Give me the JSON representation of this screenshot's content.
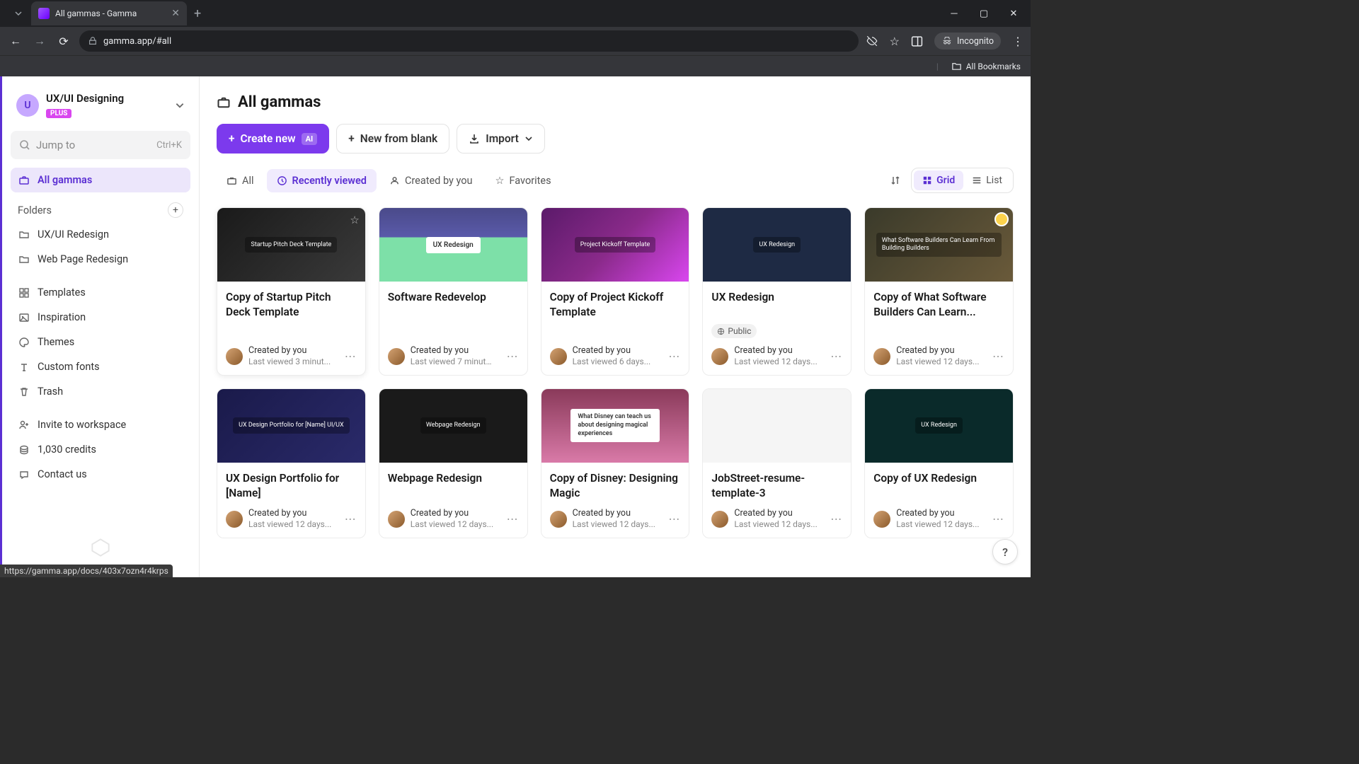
{
  "browser": {
    "tab_title": "All gammas - Gamma",
    "url": "gamma.app/#all",
    "incognito_label": "Incognito",
    "bookmarks_label": "All Bookmarks"
  },
  "workspace": {
    "avatar_letter": "U",
    "name": "UX/UI Designing",
    "badge": "PLUS"
  },
  "jump": {
    "placeholder": "Jump to",
    "shortcut": "Ctrl+K"
  },
  "sidebar": {
    "all_gammas": "All gammas",
    "folders_label": "Folders",
    "folders": [
      {
        "label": "UX/UI Redesign"
      },
      {
        "label": "Web Page Redesign"
      }
    ],
    "links": [
      {
        "label": "Templates",
        "icon": "grid"
      },
      {
        "label": "Inspiration",
        "icon": "image"
      },
      {
        "label": "Themes",
        "icon": "palette"
      },
      {
        "label": "Custom fonts",
        "icon": "type"
      },
      {
        "label": "Trash",
        "icon": "trash"
      }
    ],
    "footer": [
      {
        "label": "Invite to workspace",
        "icon": "user-plus"
      },
      {
        "label": "1,030 credits",
        "icon": "coin"
      },
      {
        "label": "Contact us",
        "icon": "chat"
      }
    ]
  },
  "header": {
    "title": "All gammas"
  },
  "actions": {
    "create": "Create new",
    "create_badge": "AI",
    "blank": "New from blank",
    "import": "Import"
  },
  "filters": {
    "all": "All",
    "recent": "Recently viewed",
    "mine": "Created by you",
    "fav": "Favorites",
    "grid": "Grid",
    "list": "List"
  },
  "cards": [
    {
      "title": "Copy of Startup Pitch Deck Template",
      "by": "Created by you",
      "viewed": "Last viewed 3 minut...",
      "thumb": "t1",
      "thumb_text": "Startup Pitch\nDeck Template",
      "hover": true
    },
    {
      "title": "Software Redevelop",
      "by": "Created by you",
      "viewed": "Last viewed 7 minute...",
      "thumb": "t2",
      "thumb_text": "UX Redesign"
    },
    {
      "title": "Copy of Project Kickoff Template",
      "by": "Created by you",
      "viewed": "Last viewed 6 days...",
      "thumb": "t3",
      "thumb_text": "Project Kickoff Template"
    },
    {
      "title": "UX Redesign",
      "by": "Created by you",
      "viewed": "Last viewed 12 days...",
      "thumb": "t4",
      "thumb_text": "UX Redesign",
      "public": true
    },
    {
      "title": "Copy of What Software Builders Can Learn...",
      "by": "Created by you",
      "viewed": "Last viewed 12 days...",
      "thumb": "t5",
      "thumb_text": "What Software Builders Can Learn From Building Builders",
      "badge_star": true
    },
    {
      "title": "UX Design Portfolio for [Name]",
      "by": "Created by you",
      "viewed": "Last viewed 12 days...",
      "thumb": "t6",
      "thumb_text": "UX Design Portfolio for [Name]   UI/UX"
    },
    {
      "title": "Webpage Redesign",
      "by": "Created by you",
      "viewed": "Last viewed 12 days...",
      "thumb": "t7",
      "thumb_text": "Webpage Redesign"
    },
    {
      "title": "Copy of Disney: Designing Magic",
      "by": "Created by you",
      "viewed": "Last viewed 12 days...",
      "thumb": "t8",
      "thumb_text": "What Disney can teach us about designing magical experiences"
    },
    {
      "title": "JobStreet-resume-template-3",
      "by": "Created by you",
      "viewed": "Last viewed 12 days...",
      "thumb": "t9",
      "thumb_text": ""
    },
    {
      "title": "Copy of UX Redesign",
      "by": "Created by you",
      "viewed": "Last viewed 12 days...",
      "thumb": "t10",
      "thumb_text": "UX Redesign"
    }
  ],
  "public_label": "Public",
  "status_url": "https://gamma.app/docs/403x7ozn4r4krps",
  "help": "?"
}
